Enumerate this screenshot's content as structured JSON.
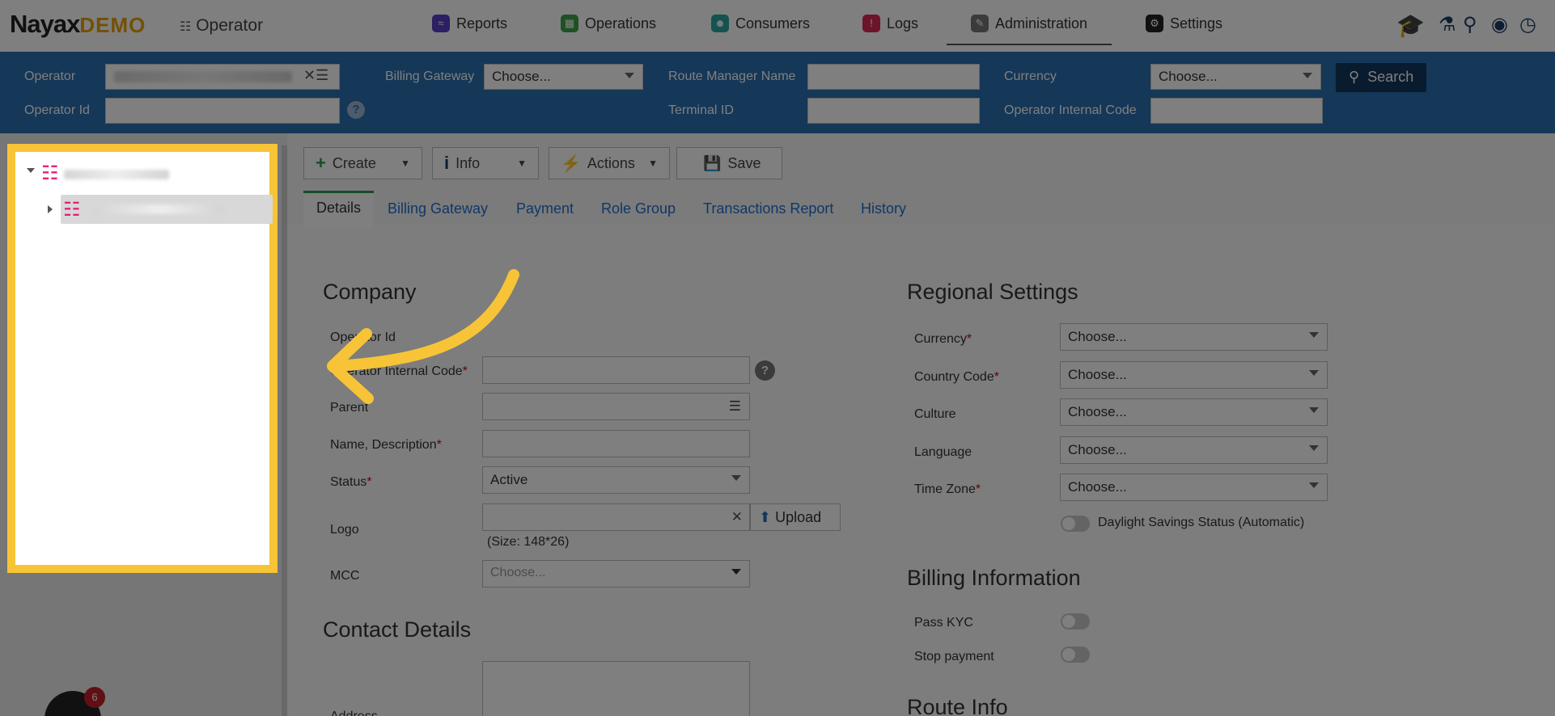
{
  "brand": {
    "name": "Nayax",
    "suffix": "DEMO",
    "section": "Operator"
  },
  "nav": [
    {
      "label": "Reports",
      "icon": "reports-icon",
      "color": "#5b3fc9"
    },
    {
      "label": "Operations",
      "icon": "operations-icon",
      "color": "#3ca34a"
    },
    {
      "label": "Consumers",
      "icon": "consumers-icon",
      "color": "#2aa7a0"
    },
    {
      "label": "Logs",
      "icon": "logs-icon",
      "color": "#d92a55"
    },
    {
      "label": "Administration",
      "icon": "administration-icon",
      "color": "#777777"
    },
    {
      "label": "Settings",
      "icon": "settings-icon",
      "color": "#222222"
    }
  ],
  "filters": {
    "operator": "Operator",
    "operator_id": "Operator Id",
    "billing_gateway": "Billing Gateway",
    "billing_gateway_value": "Choose...",
    "route_manager": "Route Manager Name",
    "terminal_id": "Terminal ID",
    "currency": "Currency",
    "currency_value": "Choose...",
    "internal_code": "Operator Internal Code",
    "search": "Search"
  },
  "toolbar": {
    "create": "Create",
    "info": "Info",
    "actions": "Actions",
    "save": "Save"
  },
  "tabs": [
    "Details",
    "Billing Gateway",
    "Payment",
    "Role Group",
    "Transactions Report",
    "History"
  ],
  "company": {
    "title": "Company",
    "operator_id": "Operator Id",
    "internal_code": "Operator Internal Code",
    "parent": "Parent",
    "name": "Name, Description",
    "status": "Status",
    "status_value": "Active",
    "logo": "Logo",
    "upload": "Upload",
    "size_hint": "(Size: 148*26)",
    "mcc": "MCC",
    "mcc_value": "Choose..."
  },
  "contact": {
    "title": "Contact Details",
    "address": "Address"
  },
  "regional": {
    "title": "Regional Settings",
    "currency": "Currency",
    "country": "Country Code",
    "culture": "Culture",
    "language": "Language",
    "timezone": "Time Zone",
    "choose": "Choose...",
    "dst": "Daylight Savings Status (Automatic)"
  },
  "billing": {
    "title": "Billing Information",
    "kyc": "Pass KYC",
    "stop": "Stop payment"
  },
  "route": {
    "title": "Route Info"
  },
  "badge": {
    "count": "6"
  }
}
